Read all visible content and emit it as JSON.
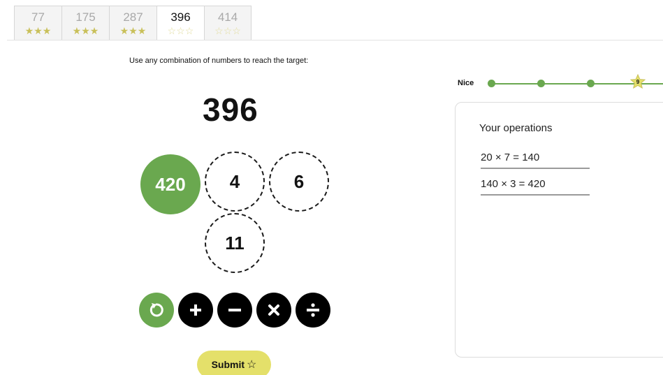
{
  "tabs": [
    {
      "number": "77",
      "stars": "★★★",
      "state": "complete"
    },
    {
      "number": "175",
      "stars": "★★★",
      "state": "complete"
    },
    {
      "number": "287",
      "stars": "★★★",
      "state": "complete"
    },
    {
      "number": "396",
      "stars": "☆☆☆",
      "state": "active"
    },
    {
      "number": "414",
      "stars": "☆☆☆",
      "state": "locked"
    }
  ],
  "instruction": "Use any combination of numbers to reach the target:",
  "target": "396",
  "numbers": {
    "selected": "420",
    "n1": "4",
    "n2": "6",
    "n3": "11"
  },
  "operations": {
    "undo": "undo-icon",
    "add": "plus-icon",
    "subtract": "minus-icon",
    "multiply": "times-icon",
    "divide": "divide-icon"
  },
  "submit": {
    "label": "Submit",
    "icon": "☆"
  },
  "progress": {
    "label": "Nice",
    "star_value": "9"
  },
  "panel": {
    "title": "Your operations",
    "rows": [
      "20 × 7 = 140",
      "140 × 3 = 420"
    ]
  },
  "colors": {
    "green": "#6aa84f",
    "yellow": "#e4e06a",
    "star": "#c9c05a"
  }
}
